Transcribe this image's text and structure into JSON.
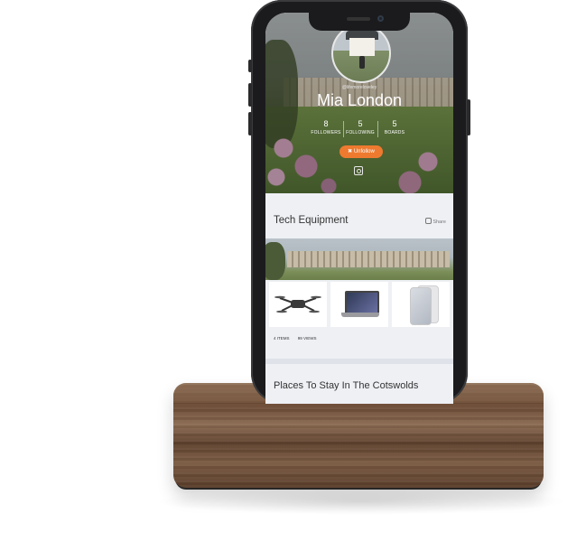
{
  "profile": {
    "handle": "@lifemoreloveley",
    "name": "Mia London",
    "stats": [
      {
        "value": "8",
        "label": "FOLLOWERS"
      },
      {
        "value": "5",
        "label": "FOLLOWING"
      },
      {
        "value": "5",
        "label": "BOARDS"
      }
    ],
    "unfollow_label": "✖ Unfollow",
    "instagram_icon": "instagram-icon"
  },
  "boards": [
    {
      "title": "Tech Equipment",
      "share_label": "Share",
      "items_label": "4 ITEMS",
      "views_label": "99 VIEWS",
      "products": [
        "drone",
        "laptop",
        "smartphone"
      ]
    },
    {
      "title": "Places To Stay In The Cotswolds"
    }
  ],
  "colors": {
    "accent": "#ee7a2f",
    "phone_body": "#1b1b1d",
    "card_bg": "#eef0f4"
  }
}
